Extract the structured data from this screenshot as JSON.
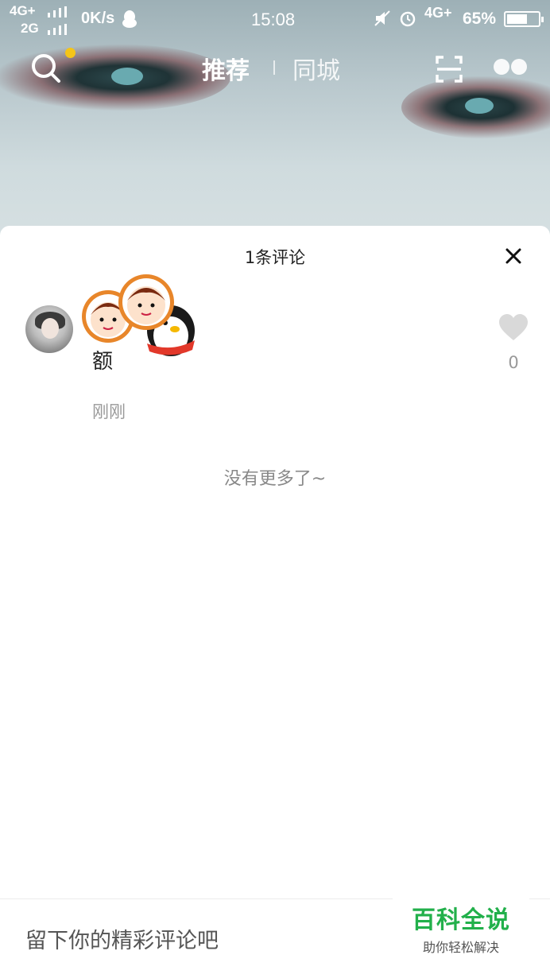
{
  "status_bar": {
    "network_top": "4G+",
    "network_bottom": "2G",
    "speed": "0K/s",
    "time": "15:08",
    "network_right": "4G+",
    "battery_percent": "65%",
    "battery_level": 0.65
  },
  "top_nav": {
    "tab_active": "推荐",
    "tab_inactive": "同城",
    "notify_dot_color": "#f5c518"
  },
  "comments_sheet": {
    "title": "1条评论",
    "comments": [
      {
        "text": "额",
        "time": "刚刚",
        "likes": "0"
      }
    ],
    "footer": "没有更多了~"
  },
  "input_bar": {
    "placeholder": "留下你的精彩评论吧"
  },
  "watermark": {
    "title": "百科全说",
    "subtitle": "助你轻松解决"
  },
  "colors": {
    "accent_green": "#22b04b",
    "muted_text": "#999999"
  }
}
